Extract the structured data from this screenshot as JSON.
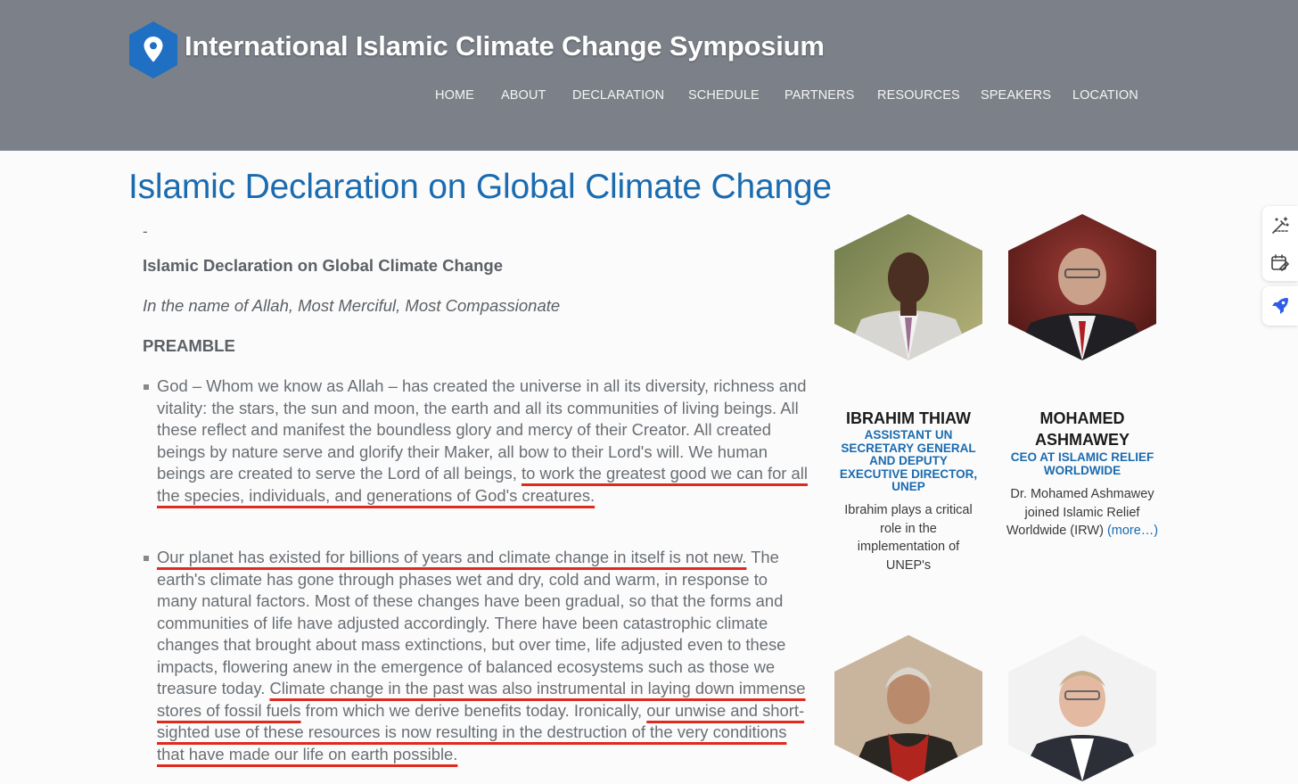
{
  "header": {
    "site_title": "International Islamic Climate Change Symposium",
    "logo_icon": "map-pin-icon",
    "brand_color": "#1f6fc2",
    "nav": [
      "HOME",
      "ABOUT",
      "DECLARATION",
      "SCHEDULE",
      "PARTNERS",
      "RESOURCES",
      "SPEAKERS",
      "LOCATION"
    ]
  },
  "main": {
    "page_title": "Islamic Declaration on Global Climate Change",
    "dash": "-",
    "sub_heading": "Islamic Declaration on Global Climate Change",
    "bismillah": "In the name of Allah, Most Merciful, Most Compassionate",
    "preamble": "PREAMBLE",
    "para1": {
      "text1": "God – Whom we know as Allah – has created the universe in all its diversity, richness and vitality: the stars, the sun and moon, the earth and all its communities of living beings. All these reflect and manifest the boundless glory and mercy of their Creator. All created beings by nature serve and glorify their Maker, all bow to their Lord's will. We human beings are created to serve the Lord of all beings,",
      "highlight1": "to work the greatest good we can for all the species, individuals, and generations of God's creatures."
    },
    "para2": {
      "highlight1": "Our planet has existed for billions of years and climate change in itself is not new.",
      "text1": "The earth's climate has gone through phases wet and dry, cold and warm, in response to many natural factors. Most of these changes have been gradual, so that the forms and communities of life have adjusted accordingly. There have been catastrophic climate changes that brought about mass extinctions, but over time, life adjusted even to these impacts, flowering anew in the emergence of balanced ecosystems such as those we treasure today.",
      "highlight2": "Climate change in the past was also instrumental in laying down immense stores of fossil fuels",
      "text2": "from which we derive benefits today. Ironically,",
      "highlight3": "our unwise and short-sighted use of these resources is now resulting in the destruction of the very conditions that have made our life on earth possible."
    }
  },
  "speakers": [
    {
      "name": "IBRAHIM THIAW",
      "role": "ASSISTANT UN SECRETARY GENERAL AND DEPUTY EXECUTIVE DIRECTOR, UNEP",
      "bio": "Ibrahim plays a critical role in the implementation of UNEP's",
      "more": ""
    },
    {
      "name": "MOHAMED ASHMAWEY",
      "role": "CEO AT ISLAMIC RELIEF WORLDWIDE",
      "bio": "Dr. Mohamed Ashmawey joined Islamic Relief Worldwide (IRW)",
      "more": "(more…)"
    }
  ],
  "side_tools": [
    "magic-edit-icon",
    "calendar-edit-icon",
    "rocket-icon"
  ]
}
